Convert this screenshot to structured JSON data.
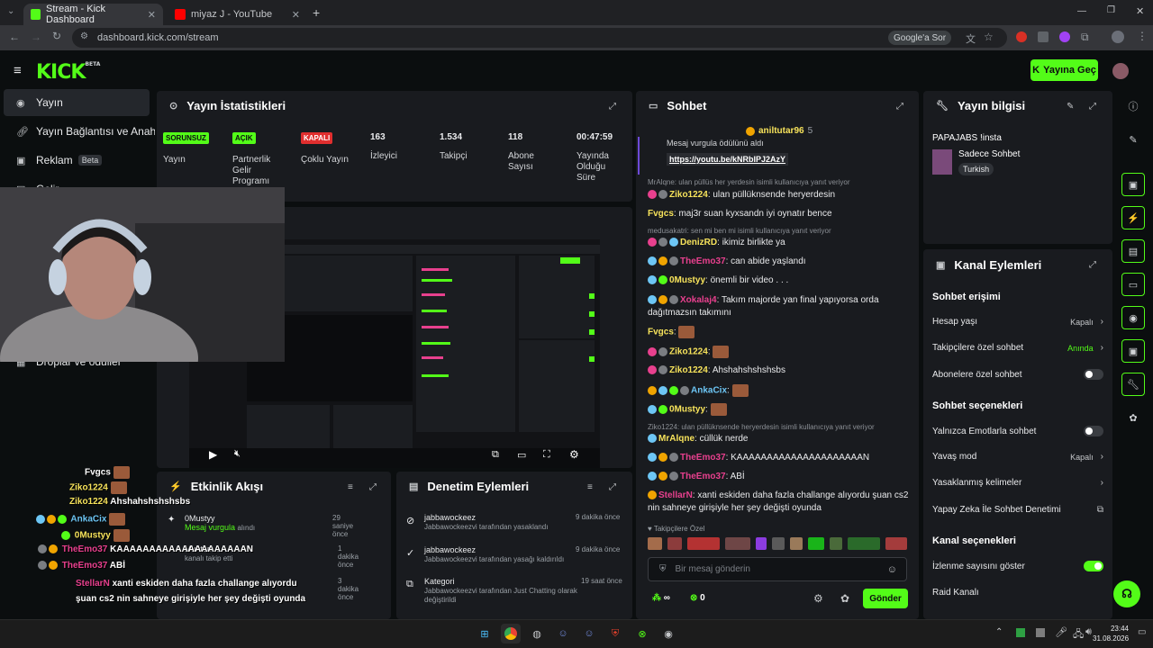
{
  "browser": {
    "tabs": [
      {
        "title": "Stream - Kick Dashboard",
        "close": "✕"
      },
      {
        "title": "miyaz J - YouTube",
        "close": "✕"
      }
    ],
    "new_tab": "+",
    "url": "dashboard.kick.com/stream",
    "google_chip": "Google'a Sor"
  },
  "header": {
    "logo": "KICK",
    "logo_tag": "BETA",
    "go_live": "Yayına Geç"
  },
  "sidebar": {
    "items": [
      {
        "label": "Yayın"
      },
      {
        "label": "Yayın Bağlantısı ve Anahtarı"
      },
      {
        "label": "Reklam",
        "badge": "Beta"
      },
      {
        "label": "Gelir"
      },
      {
        "label": "Droplar ve ödüller"
      }
    ]
  },
  "stats": {
    "title": "Yayın İstatistikleri",
    "cards": [
      {
        "value": "SORUNSUZ",
        "label": "Yayın"
      },
      {
        "value": "AÇIK",
        "label": "Partnerlik Gelir Programı"
      },
      {
        "value": "KAPALI",
        "label": "Çoklu Yayın"
      },
      {
        "value": "163",
        "label": "İzleyici"
      },
      {
        "value": "1.534",
        "label": "Takipçi"
      },
      {
        "value": "118",
        "label": "Abone Sayısı"
      },
      {
        "value": "00:47:59",
        "label": "Yayında Olduğu Süre"
      }
    ]
  },
  "preview": {
    "title_suffix": "esi"
  },
  "events": {
    "title": "Etkinlik Akışı",
    "items": [
      {
        "user": "0Mustyy",
        "detail": "Mesaj vurgula",
        "detail2": "alındı",
        "time": "29 saniye önce"
      },
      {
        "user": "Muhtam…",
        "detail": "kanalı takip etti",
        "time": "1 dakika önce"
      },
      {
        "user": "Alko…",
        "detail": "…",
        "time": "3 dakika önce"
      }
    ]
  },
  "moderation": {
    "title": "Denetim Eylemleri",
    "items": [
      {
        "user": "jabbawockeez",
        "detail": "Jabbawockeezvi tarafından yasaklandı",
        "time": "9 dakika önce"
      },
      {
        "user": "jabbawockeez",
        "detail": "Jabbawockeezvi tarafından yasağı kaldırıldı",
        "time": "9 dakika önce"
      },
      {
        "user": "Kategori",
        "detail": "Jabbawockeezvi tarafından Just Chatting olarak değiştirildi",
        "time": "19 saat önce"
      }
    ]
  },
  "chat": {
    "title": "Sohbet",
    "pinned_user": "aniltutar96",
    "pinned_count": "5",
    "pinned_text": "Mesaj vurgula ödülünü aldı",
    "pinned_link": "https://youtu.be/kNRbIPJ2AzY",
    "messages": [
      {
        "reply": "MrAlqne: ulan püllüs her yerdesin isimli kullanıcıya yanıt veriyor"
      },
      {
        "user": "Ziko1224",
        "color": "#f7e35b",
        "text": "ulan püllüknsende heryerdesin"
      },
      {
        "user": "Fvgcs",
        "color": "#f7e35b",
        "text": "maj3r suan kyxsandn iyi oynatır bence"
      },
      {
        "reply": "medusakatri: sen mi ben mi isimli kullanıcıya yanıt veriyor"
      },
      {
        "user": "DenizRD",
        "color": "#f7e35b",
        "text": "ikimiz birlikte ya"
      },
      {
        "user": "TheEmo37",
        "color": "#e8408e",
        "text": "can abide yaşlandı"
      },
      {
        "user": "0Mustyy",
        "color": "#f7e35b",
        "text": "önemli bir video . . ."
      },
      {
        "user": "Xokalaj4",
        "color": "#e8408e",
        "text": "Takım majorde yan final yapıyorsa orda dağıtmazsın takımını"
      },
      {
        "user": "Fvgcs",
        "color": "#f7e35b",
        "text": ""
      },
      {
        "user": "Ziko1224",
        "color": "#f7e35b",
        "text": ""
      },
      {
        "user": "Ziko1224",
        "color": "#f7e35b",
        "text": "Ahshahshshshsbs"
      },
      {
        "user": "AnkaCix",
        "color": "#6dc6f5",
        "text": ""
      },
      {
        "user": "0Mustyy",
        "color": "#f7e35b",
        "text": ""
      },
      {
        "reply": "Ziko1224: ulan püllüknsende heryerdesin isimli kullanıcıya yanıt veriyor"
      },
      {
        "user": "MrAlqne",
        "color": "#f7e35b",
        "text": "cüllük nerde"
      },
      {
        "user": "TheEmo37",
        "color": "#e8408e",
        "text": "KAAAAAAAAAAAAAAAAAAAAAN"
      },
      {
        "user": "TheEmo37",
        "color": "#e8408e",
        "text": "ABİ"
      },
      {
        "user": "StellarN",
        "color": "#e8408e",
        "text": "xanti eskiden daha fazla challange alıyordu şuan cs2 nin sahneye girişiyle her şey değişti oyunda"
      }
    ],
    "follower_label": "Takipçilere Özel",
    "input_placeholder": "Bir mesaj gönderin",
    "send": "Gönder",
    "count_left": "∞",
    "count_right": "0"
  },
  "stream_info": {
    "title": "Yayın bilgisi",
    "stream_title": "PAPAJABS !insta",
    "category": "Sadece Sohbet",
    "tag": "Turkish"
  },
  "channel_actions": {
    "title": "Kanal Eylemleri",
    "sections": [
      {
        "heading": "Sohbet erişimi",
        "rows": [
          {
            "label": "Hesap yaşı",
            "value": "Kapalı"
          },
          {
            "label": "Takipçilere özel sohbet",
            "value": "Anında"
          },
          {
            "label": "Abonelere özel sohbet",
            "value": ""
          }
        ]
      },
      {
        "heading": "Sohbet seçenekleri",
        "rows": [
          {
            "label": "Yalnızca Emotlarla sohbet",
            "value": ""
          },
          {
            "label": "Yavaş mod",
            "value": "Kapalı"
          },
          {
            "label": "Yasaklanmış kelimeler",
            "value": ""
          },
          {
            "label": "Yapay Zeka İle Sohbet Denetimi",
            "value": ""
          }
        ]
      },
      {
        "heading": "Kanal seçenekleri",
        "rows": [
          {
            "label": "İzlenme sayısını göster",
            "value": ""
          },
          {
            "label": "Raid Kanalı",
            "value": ""
          }
        ]
      }
    ]
  },
  "overlay_chat": [
    {
      "user": "Fvgcs",
      "text": ""
    },
    {
      "user": "Ziko1224",
      "text": ""
    },
    {
      "user": "Ziko1224",
      "text": "Ahshahshshshsbs"
    },
    {
      "user": "AnkaCix",
      "text": ""
    },
    {
      "user": "0Mustyy",
      "text": ""
    },
    {
      "user": "TheEmo37",
      "text": "KAAAAAAAAAAAAAAAAAAAAN"
    },
    {
      "user": "TheEmo37",
      "text": "ABİ"
    },
    {
      "user": "StellarN",
      "text": "xanti eskiden daha fazla challange alıyordu şuan cs2 nin sahneye girişiyle her şey değişti oyunda"
    }
  ],
  "taskbar": {
    "time": "23:44",
    "date": "31.08.2026"
  },
  "colors": {
    "accent": "#53fc18",
    "panel": "#191b1f",
    "background": "#0b0e0f"
  }
}
